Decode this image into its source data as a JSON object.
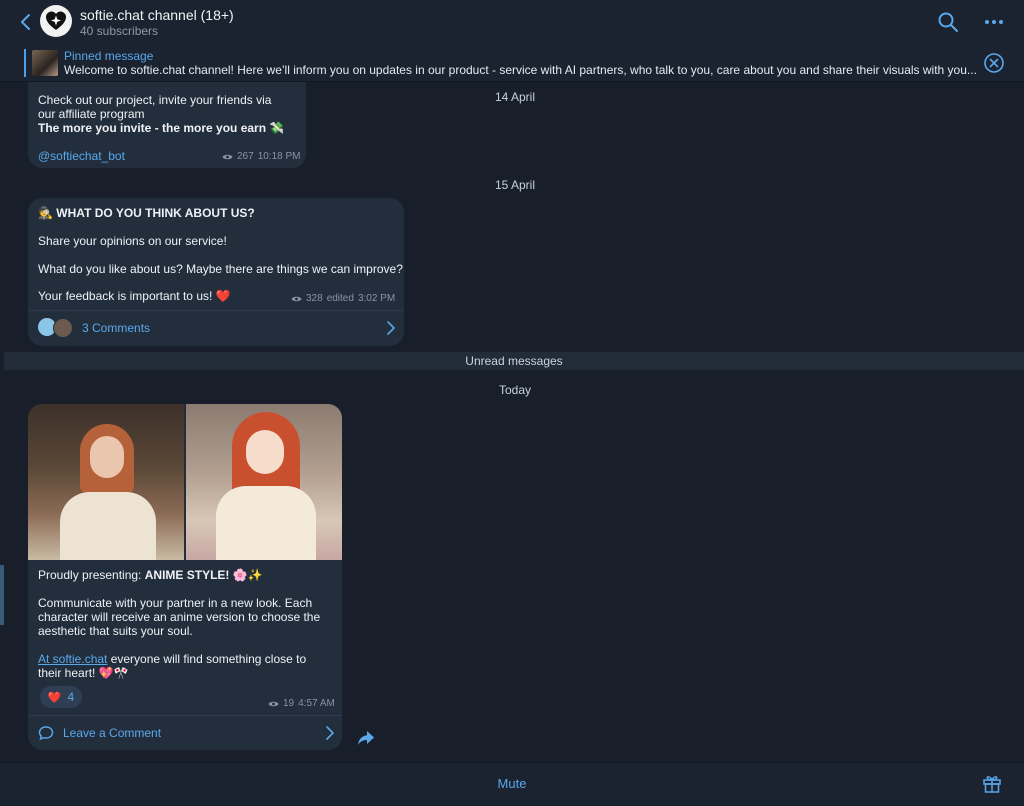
{
  "header": {
    "title": "softie.chat channel (18+)",
    "subtitle": "40 subscribers"
  },
  "pinned": {
    "label": "Pinned message",
    "text": "Welcome to softie.chat channel!  Here we’ll inform you on updates in our product - service with AI partners, who talk to you, care about you and share their visuals with you..."
  },
  "dates": [
    "14 April",
    "15 April",
    "Today"
  ],
  "unread_label": "Unread messages",
  "messages": [
    {
      "line1": "Check out our project, invite your friends via",
      "line2": "our affiliate program",
      "bold": "The more you invite - the more you earn",
      "emoji": "💸",
      "link": "@softiechat_bot",
      "views": "267",
      "time": "10:18 PM"
    },
    {
      "title_emoji": "🕵️",
      "title": "WHAT DO YOU THINK ABOUT US?",
      "p1": "Share your opinions on our service!",
      "p2": "What do you like about us? Maybe there are things we can improve?",
      "p3": "Your feedback is important to us!",
      "p3_emoji": "❤️",
      "views": "328",
      "edited": "edited",
      "time": "3:02 PM",
      "comments": "3 Comments"
    },
    {
      "p1_prefix": "Proudly presenting: ",
      "p1_bold": "ANIME STYLE!",
      "p1_emoji": "🌸✨",
      "p2_line1": "Communicate with your partner in a new look. Each",
      "p2_line2": "character will receive an anime version to choose the",
      "p2_line3": "aesthetic that suits your soul.",
      "p3_link": "At softie.chat",
      "p3_rest": " everyone will find something close to",
      "p3_line2": "their heart!",
      "p3_emoji": "💖🎌",
      "reaction_emoji": "❤️",
      "reaction_count": "4",
      "views": "19",
      "time": "4:57 AM",
      "comment_label": "Leave a Comment"
    }
  ],
  "bottom": {
    "mute_label": "Mute"
  },
  "colors": {
    "accent": "#5aa8ec",
    "background": "#181f2a",
    "bubble": "#232e3d"
  },
  "icons": [
    "back-arrow-icon",
    "search-icon",
    "more-icon",
    "close-circle-icon",
    "eye-icon",
    "chevron-right-icon",
    "comment-icon",
    "share-icon",
    "gift-icon"
  ]
}
